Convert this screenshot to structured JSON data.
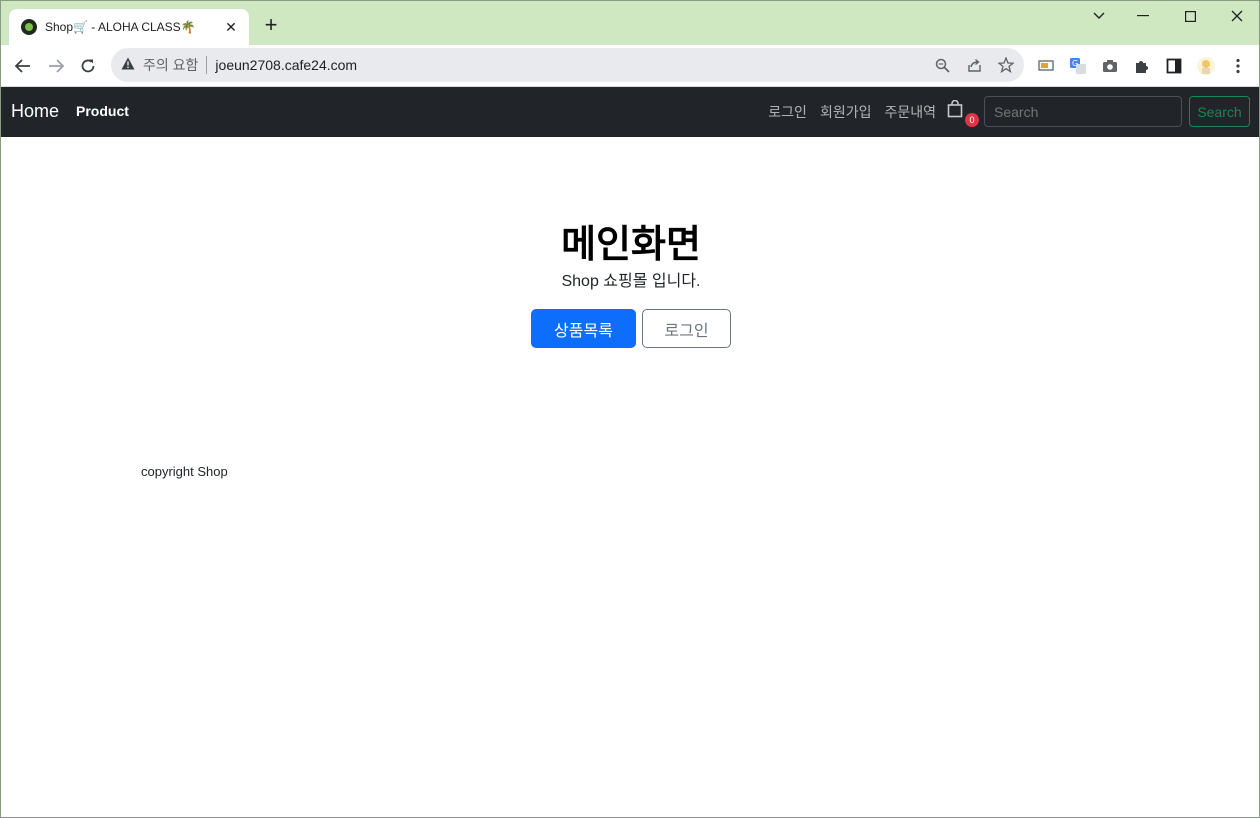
{
  "browser": {
    "tab_title": "Shop🛒 - ALOHA CLASS🌴",
    "security_label": "주의 요함",
    "url": "joeun2708.cafe24.com"
  },
  "site": {
    "brand": "Home",
    "nav_product": "Product",
    "nav_links": [
      "로그인",
      "회원가입",
      "주문내역"
    ],
    "cart_count": "0",
    "search_placeholder": "Search",
    "search_button": "Search"
  },
  "main": {
    "title": "메인화면",
    "subtitle": "Shop 쇼핑몰 입니다.",
    "primary_button": "상품목록",
    "secondary_button": "로그인"
  },
  "footer": {
    "text": "copyright Shop"
  },
  "colors": {
    "navbar_bg": "#212529",
    "primary": "#0d6efd",
    "success": "#198754",
    "badge": "#dc3545"
  }
}
